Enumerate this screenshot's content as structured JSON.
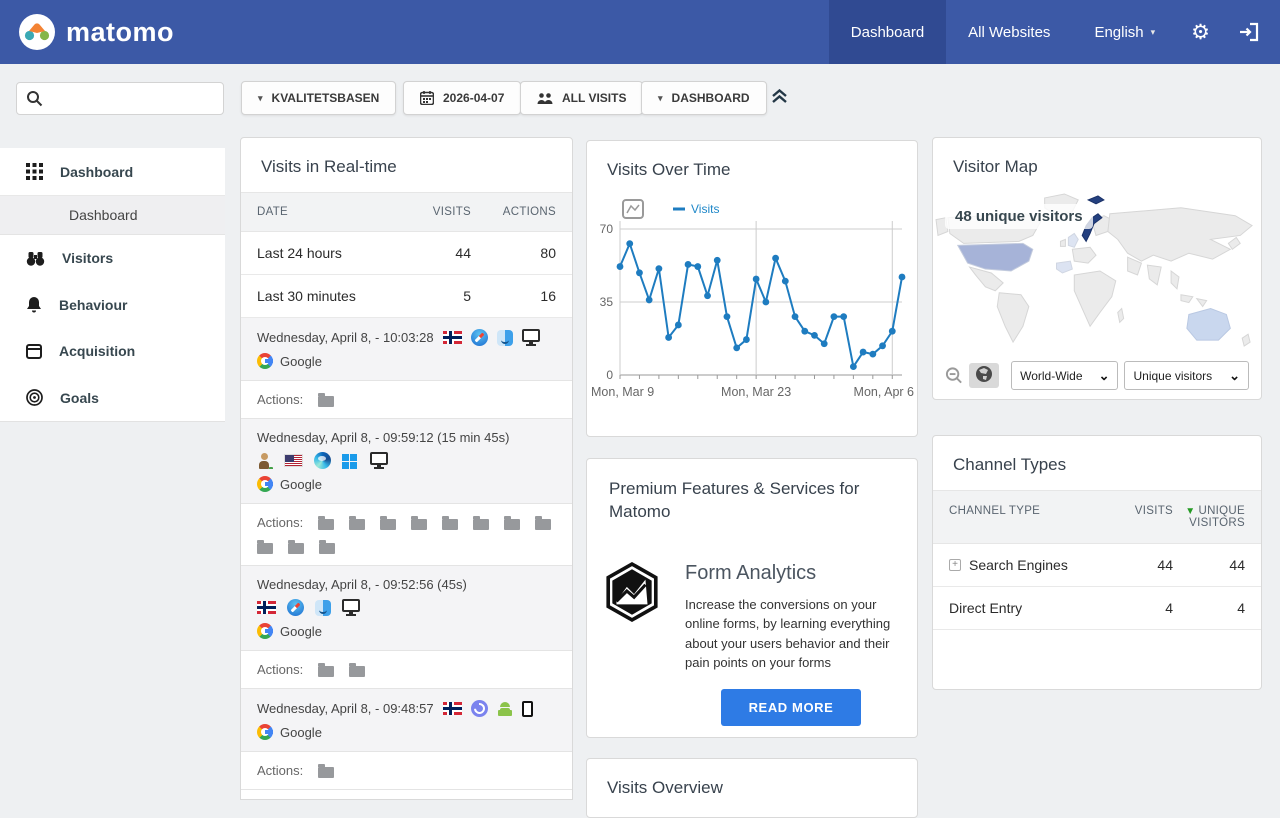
{
  "navbar": {
    "brand": "matomo",
    "tabs": [
      {
        "label": "Dashboard",
        "active": true
      },
      {
        "label": "All Websites",
        "active": false
      },
      {
        "label": "English",
        "active": false,
        "has_caret": true
      }
    ],
    "icons": [
      "settings-gear-icon",
      "sign-in-icon"
    ]
  },
  "toolbar": {
    "search_value": "",
    "site_selector_label": "KVALITETSBASEN",
    "date_label": "2026-04-07",
    "segment_label": "ALL VISITS",
    "dashboard_selector_label": "DASHBOARD"
  },
  "sidebar": {
    "items": [
      {
        "label": "Dashboard",
        "icon": "dashboard-grid-icon"
      },
      {
        "label": "Dashboard",
        "sub": true,
        "active": true
      },
      {
        "label": "Visitors",
        "icon": "binoculars-icon"
      },
      {
        "label": "Behaviour",
        "icon": "bell-icon"
      },
      {
        "label": "Acquisition",
        "icon": "browser-window-icon"
      },
      {
        "label": "Goals",
        "icon": "target-icon"
      }
    ]
  },
  "realtime": {
    "title": "Visits in Real-time",
    "columns": [
      "DATE",
      "VISITS",
      "ACTIONS"
    ],
    "actions_label": "Actions:",
    "summary_rows": [
      {
        "date": "Last 24 hours",
        "visits": "44",
        "actions": "80"
      },
      {
        "date": "Last 30 minutes",
        "visits": "5",
        "actions": "16"
      }
    ],
    "visits": [
      {
        "datetime": "Wednesday, April 8, - 10:03:28",
        "icons": [
          "norway-flag-icon",
          "safari-icon",
          "macos-icon",
          "desktop-icon"
        ],
        "referrer": "Google",
        "action_folders": 1
      },
      {
        "datetime": "Wednesday, April 8, - 09:59:12 (15 min 45s)",
        "icons": [
          "returning-visitor-icon",
          "us-flag-icon",
          "edge-icon",
          "windows-icon",
          "desktop-icon"
        ],
        "referrer": "Google",
        "action_folders": 11
      },
      {
        "datetime": "Wednesday, April 8, - 09:52:56 (45s)",
        "icons": [
          "norway-flag-icon",
          "safari-icon",
          "macos-icon",
          "desktop-icon"
        ],
        "referrer": "Google",
        "action_folders": 2
      },
      {
        "datetime": "Wednesday, April 8, - 09:48:57",
        "icons": [
          "norway-flag-icon",
          "samsung-internet-icon",
          "android-icon",
          "smartphone-icon"
        ],
        "referrer": "Google",
        "action_folders": 1
      }
    ]
  },
  "chart_data": {
    "type": "line",
    "title": "Visits Over Time",
    "series": [
      {
        "name": "Visits",
        "color": "#1e7cc0",
        "values": [
          52,
          63,
          49,
          36,
          51,
          18,
          24,
          53,
          52,
          38,
          55,
          28,
          13,
          17,
          46,
          35,
          56,
          45,
          28,
          21,
          19,
          15,
          28,
          28,
          4,
          11,
          10,
          14,
          21,
          47
        ]
      }
    ],
    "x_ticks": [
      {
        "index": 0,
        "label": "Mon, Mar 9"
      },
      {
        "index": 14,
        "label": "Mon, Mar 23"
      },
      {
        "index": 28,
        "label": "Mon, Apr 6"
      }
    ],
    "ylim": [
      0,
      70
    ],
    "yticks": [
      0,
      35,
      70
    ],
    "legend_position": "top-left",
    "grid": true
  },
  "premium": {
    "title": "Premium Features & Services for Matomo",
    "feature_title": "Form Analytics",
    "feature_description": "Increase the conversions on your online forms, by learning everything about your users behavior and their pain points on your forms",
    "cta_label": "READ MORE",
    "cta_color": "#2e7be5"
  },
  "visitor_map": {
    "title": "Visitor Map",
    "tooltip": "48 unique visitors",
    "region_select_value": "World-Wide",
    "metric_select_value": "Unique visitors",
    "land_color": "#ebebeb",
    "highlighted": [
      {
        "country": "Norway",
        "color": "#24407f"
      },
      {
        "country": "United States",
        "color": "#a6b3d8"
      },
      {
        "country": "Australia",
        "color": "#c9d7ee"
      },
      {
        "country": "United Kingdom",
        "color": "#dde4f2"
      },
      {
        "country": "Spain",
        "color": "#dce3f2"
      }
    ]
  },
  "channel_types": {
    "title": "Channel Types",
    "columns": [
      "CHANNEL TYPE",
      "VISITS",
      "UNIQUE VISITORS"
    ],
    "sorted_by": "UNIQUE VISITORS",
    "sort_arrow_color": "#259b24",
    "rows": [
      {
        "label": "Search Engines",
        "expandable": true,
        "visits": "44",
        "unique_visitors": "44"
      },
      {
        "label": "Direct Entry",
        "expandable": false,
        "visits": "4",
        "unique_visitors": "4"
      }
    ]
  },
  "visits_overview": {
    "title": "Visits Overview"
  }
}
